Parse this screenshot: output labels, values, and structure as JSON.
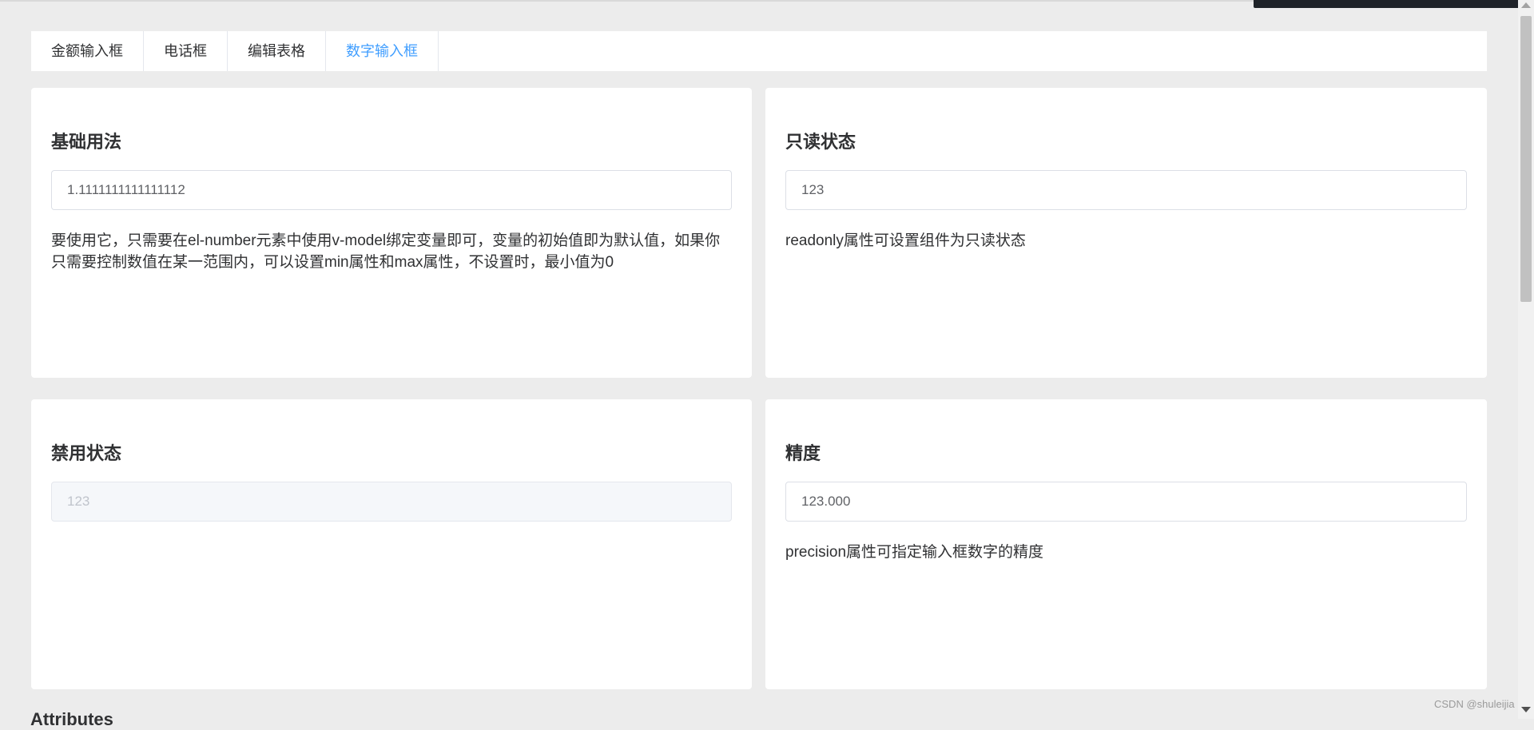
{
  "tabs": [
    {
      "label": "金额输入框",
      "active": false
    },
    {
      "label": "电话框",
      "active": false
    },
    {
      "label": "编辑表格",
      "active": false
    },
    {
      "label": "数字输入框",
      "active": true
    }
  ],
  "cards": {
    "basic": {
      "title": "基础用法",
      "value": "1.1111111111111112",
      "desc": "要使用它，只需要在el-number元素中使用v-model绑定变量即可，变量的初始值即为默认值，如果你只需要控制数值在某一范围内，可以设置min属性和max属性，不设置时，最小值为0"
    },
    "readonly": {
      "title": "只读状态",
      "value": "123",
      "desc": "readonly属性可设置组件为只读状态"
    },
    "disabled": {
      "title": "禁用状态",
      "value": "123",
      "desc": ""
    },
    "precision": {
      "title": "精度",
      "value": "123.000",
      "desc": "precision属性可指定输入框数字的精度"
    }
  },
  "section": {
    "attributes_title": "Attributes"
  },
  "watermark": "CSDN @shuleijia",
  "colors": {
    "accent": "#409eff",
    "background": "#ececec",
    "card": "#ffffff",
    "text": "#303133"
  }
}
